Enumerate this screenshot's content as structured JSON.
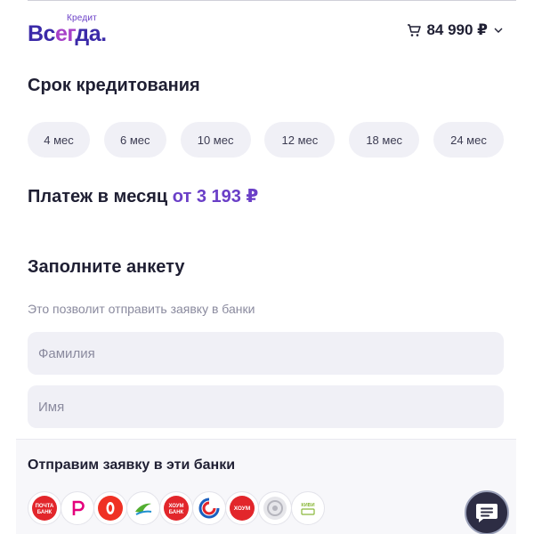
{
  "header": {
    "logo_small": "Кредит",
    "logo_part1": "Вс",
    "logo_part2": "ег",
    "logo_part3": "да.",
    "cart_price": "84 990 ₽"
  },
  "credit_term": {
    "title": "Срок кредитования",
    "options": [
      "4 мес",
      "6 мес",
      "10 мес",
      "12 мес",
      "18 мес",
      "24 мес"
    ]
  },
  "payment": {
    "label": "Платеж в месяц",
    "value": "от 3 193 ₽"
  },
  "form": {
    "title": "Заполните анкету",
    "subtitle": "Это позволит отправить заявку в банки",
    "surname_placeholder": "Фамилия",
    "name_placeholder": "Имя"
  },
  "banks": {
    "title": "Отправим заявку в эти банки",
    "items": [
      {
        "icon": "pochta-bank-icon",
        "text": "ПОЧТА БАНК",
        "color": "#e2262b"
      },
      {
        "icon": "renaissance-bank-icon",
        "color": "#e4007c"
      },
      {
        "icon": "alfa-bank-icon",
        "color": "#ef3124"
      },
      {
        "icon": "otp-bank-icon",
        "color": "#52ae30"
      },
      {
        "icon": "home-bank-icon",
        "text": "ХОУМ БАНК",
        "color": "#e2262b"
      },
      {
        "icon": "mts-bank-icon",
        "color": "#1a5fbf"
      },
      {
        "icon": "home-bank-alt-icon",
        "text": "ХОУМ",
        "color": "#e2262b"
      },
      {
        "icon": "gray-bank-icon",
        "color": "#b5b5bd"
      },
      {
        "icon": "kiwi-bank-icon",
        "text": "КИВИ",
        "color": "#8ab83a"
      }
    ]
  },
  "colors": {
    "accent": "#6a3fc7",
    "chip_bg": "#f0f0f6",
    "text_dark": "#1f1f33"
  }
}
